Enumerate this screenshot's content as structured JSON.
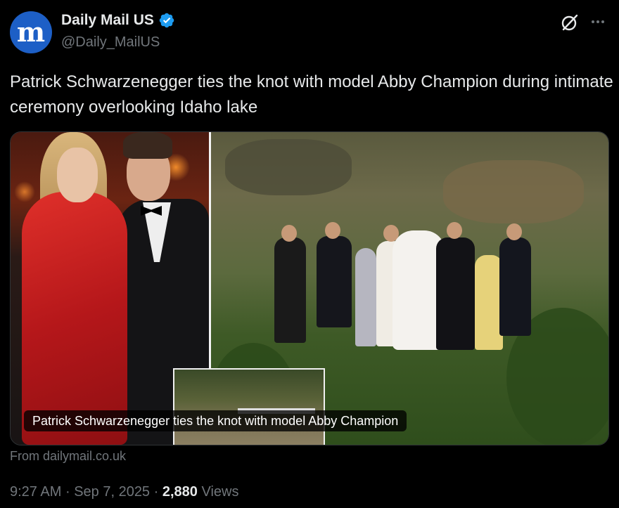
{
  "author": {
    "display_name": "Daily Mail US",
    "handle": "@Daily_MailUS",
    "avatar_letter": "m",
    "avatar_color": "#1d5fc6",
    "verified": true,
    "verified_color": "#1d9bf0"
  },
  "header_icons": [
    "grok-icon",
    "more-options-icon"
  ],
  "tweet": {
    "text": "Patrick Schwarzenegger ties the knot with model Abby Champion during intimate ceremony overlooking Idaho lake"
  },
  "media": {
    "caption": "Patrick Schwarzenegger ties the knot with model Abby Champion"
  },
  "source": "From dailymail.co.uk",
  "meta": {
    "time": "9:27 AM",
    "date": "Sep 7, 2025",
    "separator": "·",
    "views_count": "2,880",
    "views_label": "Views"
  }
}
